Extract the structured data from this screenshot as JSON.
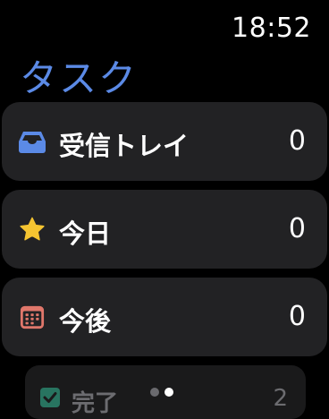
{
  "status": {
    "time": "18:52"
  },
  "title": "タスク",
  "lists": [
    {
      "label": "受信トレイ",
      "count": "0",
      "icon": "inbox-tray-icon",
      "icon_color": "#5b8ae6"
    },
    {
      "label": "今日",
      "count": "0",
      "icon": "star-icon",
      "icon_color": "#f5c431"
    },
    {
      "label": "今後",
      "count": "0",
      "icon": "calendar-icon",
      "icon_color": "#e0776b"
    }
  ],
  "done": {
    "label": "完了",
    "count": "2",
    "icon": "checkbox-icon",
    "icon_color": "#2f9a7e"
  },
  "pagination": {
    "pages": 2,
    "current": 2
  },
  "colors": {
    "background": "#000000",
    "card": "#222224",
    "title": "#5b8ae6"
  }
}
